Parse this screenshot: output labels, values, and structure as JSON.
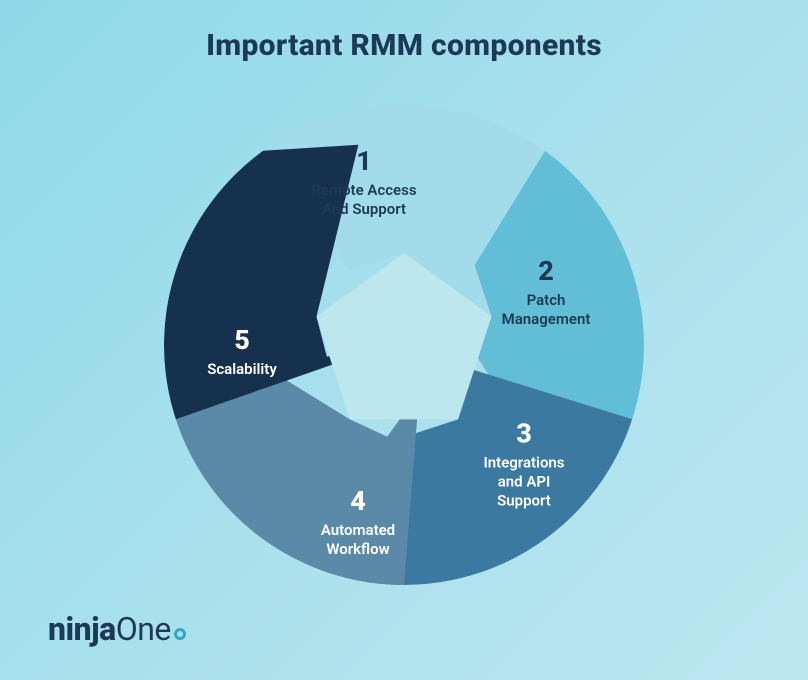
{
  "title": "Important RMM components",
  "segments": [
    {
      "num": "1",
      "label": "Remote Access\nAnd Support",
      "color": "#a2dcea",
      "textLight": false
    },
    {
      "num": "2",
      "label": "Patch\nManagement",
      "color": "#62bdd6",
      "textLight": false
    },
    {
      "num": "3",
      "label": "Integrations\nand API\nSupport",
      "color": "#3c79a0",
      "textLight": true
    },
    {
      "num": "4",
      "label": "Automated\nWorkflow",
      "color": "#5b89a8",
      "textLight": true
    },
    {
      "num": "5",
      "label": "Scalability",
      "color": "#16314e",
      "textLight": true
    }
  ],
  "centerColor": "#bce7ee",
  "logo": {
    "part1": "ninja",
    "part2": "One"
  }
}
